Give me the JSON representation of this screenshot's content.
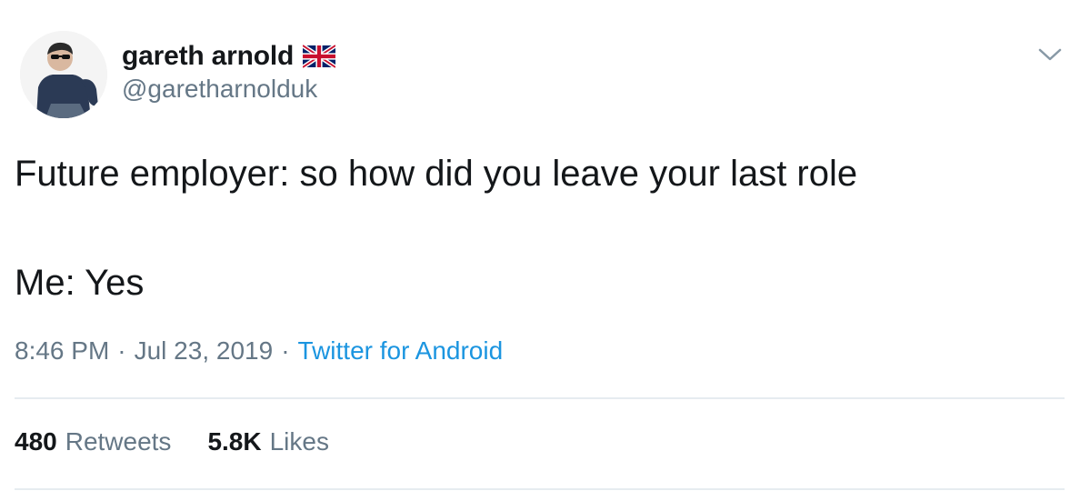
{
  "user": {
    "display_name": "gareth arnold",
    "handle": "@garetharnolduk",
    "avatar_icon": "user-avatar-photo",
    "flag_icon": "uk-flag-icon"
  },
  "tweet": {
    "lines": [
      "Future employer: so how did you leave your last role",
      "Me: Yes"
    ]
  },
  "meta": {
    "time": "8:46 PM",
    "separator": "·",
    "date": "Jul 23, 2019",
    "source": "Twitter for Android"
  },
  "stats": {
    "retweets_count": "480",
    "retweets_label": "Retweets",
    "likes_count": "5.8K",
    "likes_label": "Likes"
  },
  "menu": {
    "caret_icon": "chevron-down-icon"
  },
  "colors": {
    "text": "#14171a",
    "secondary": "#657786",
    "link": "#1b95e0",
    "divider": "#e6ecf0"
  }
}
